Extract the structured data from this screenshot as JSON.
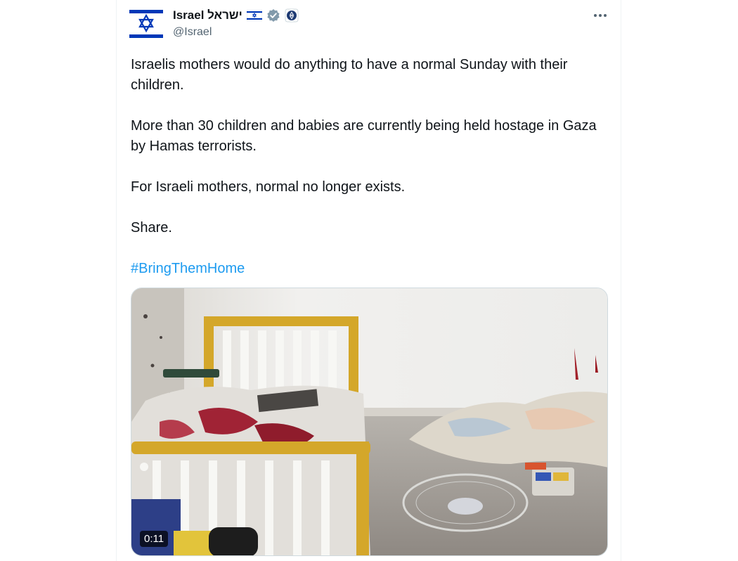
{
  "author": {
    "display_name": "Israel ישראל",
    "handle": "@Israel",
    "avatar_icon": "star-of-david-icon",
    "flag_icon": "israel-flag-icon",
    "verified_icon": "verified-gray-badge-icon",
    "affiliate_icon": "government-emblem-icon"
  },
  "menu": {
    "more_icon": "more-options-icon"
  },
  "post": {
    "line1": "Israelis mothers would do anything to have a normal Sunday with their children.",
    "line2": "More than 30 children and babies are currently being held hostage in Gaza by Hamas terrorists.",
    "line3": "For Israeli mothers, normal no longer exists.",
    "line4": "Share.",
    "hashtag": "#BringThemHome"
  },
  "media": {
    "type": "video",
    "duration": "0:11"
  },
  "colors": {
    "link": "#1d9bf0",
    "text": "#0f1419",
    "secondary": "#536471",
    "israel_blue": "#0038b8"
  }
}
